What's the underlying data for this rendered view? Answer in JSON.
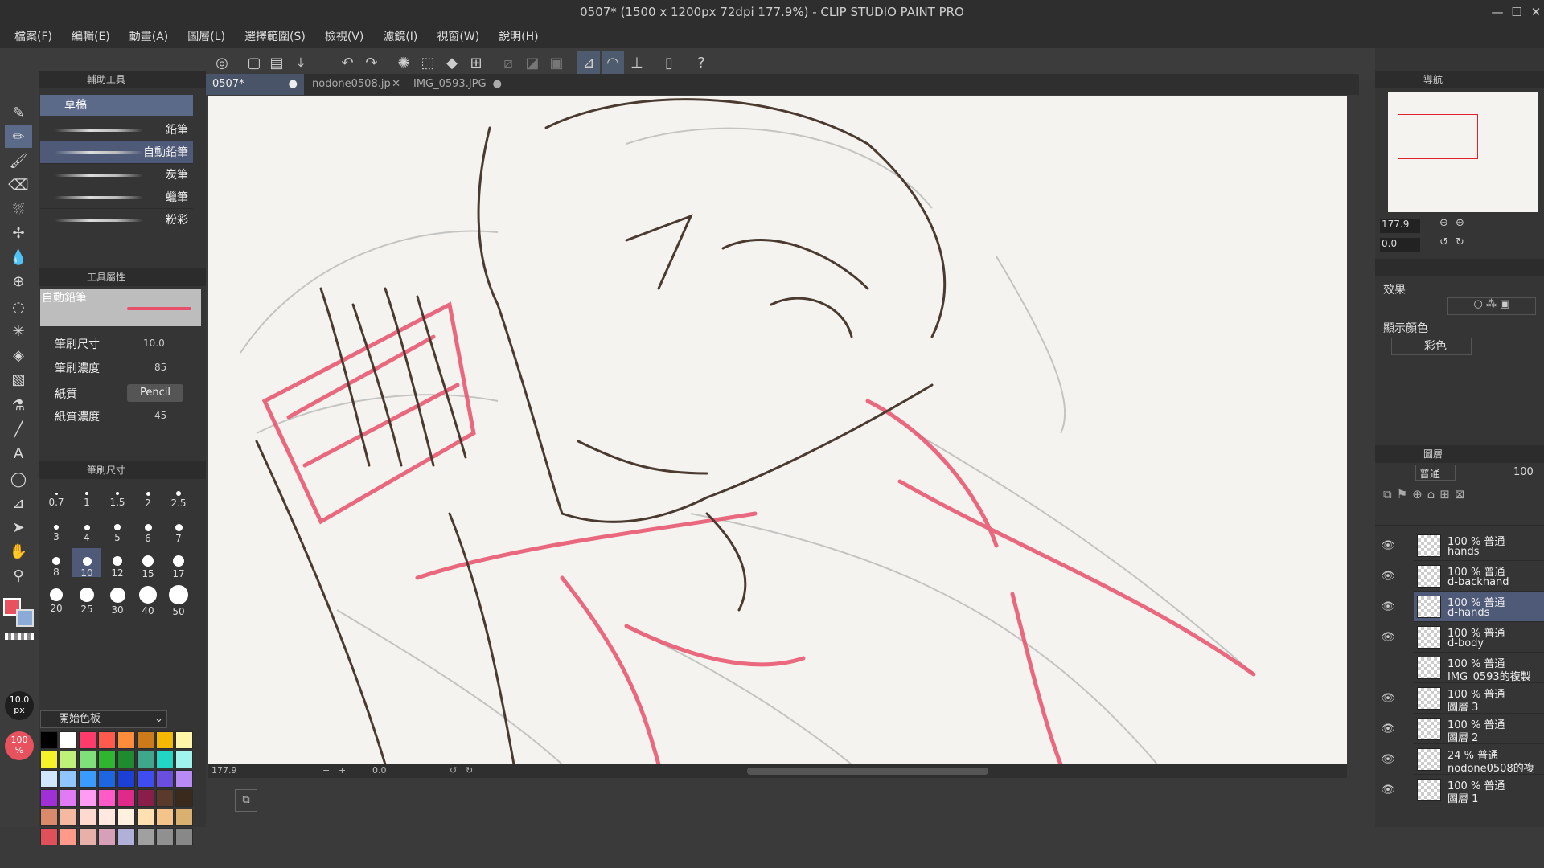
{
  "title": "0507* (1500 x 1200px 72dpi 177.9%)  - CLIP STUDIO PAINT PRO",
  "menu": [
    "檔案(F)",
    "編輯(E)",
    "動畫(A)",
    "圖層(L)",
    "選擇範圍(S)",
    "檢視(V)",
    "濾鏡(I)",
    "視窗(W)",
    "說明(H)"
  ],
  "tabs": [
    {
      "label": "0507*",
      "active": true
    },
    {
      "label": "nodone0508.jp",
      "active": false
    },
    {
      "label": "IMG_0593.JPG",
      "active": false
    }
  ],
  "sub_tool": {
    "panel_title": "輔助工具",
    "group": "草稿",
    "brushes": [
      "鉛筆",
      "自動鉛筆",
      "炭筆",
      "蠟筆",
      "粉彩"
    ],
    "selected": "自動鉛筆"
  },
  "tool_property": {
    "panel_title": "工具屬性",
    "preset_name": "自動鉛筆",
    "brush_size_label": "筆刷尺寸",
    "brush_size_value": "10.0",
    "brush_density_label": "筆刷濃度",
    "brush_density_value": "85",
    "paper_label": "紙質",
    "paper_value": "Pencil",
    "paper_density_label": "紙質濃度",
    "paper_density_value": "45"
  },
  "brush_size_panel": {
    "panel_title": "筆刷尺寸",
    "sizes": [
      "0.7",
      "1",
      "1.5",
      "2",
      "2.5",
      "3",
      "4",
      "5",
      "6",
      "7",
      "8",
      "10",
      "12",
      "15",
      "17",
      "20",
      "25",
      "30",
      "40",
      "50"
    ],
    "selected": "10"
  },
  "color_set": {
    "name": "開始色板",
    "swatches": [
      "#000000",
      "#ffffff",
      "#ff3b6b",
      "#ff5a4e",
      "#ff8c3a",
      "#cc7a1a",
      "#f5b800",
      "#fff7a8",
      "#f5f22a",
      "#bff07a",
      "#7fe07a",
      "#2fb52f",
      "#1e8c2e",
      "#3fa88a",
      "#22d6c4",
      "#9ff5ee",
      "#cfe8ff",
      "#8fc6ff",
      "#3a9bff",
      "#1e66e0",
      "#1c3fd6",
      "#3f4cf0",
      "#6a4ee0",
      "#b88af5",
      "#a02fd6",
      "#e07af5",
      "#ff9af5",
      "#ff5ac8",
      "#e02a8a",
      "#8a1e4a",
      "#5a3a2a",
      "#3a2a1e",
      "#d98a6a",
      "#f5b8a0",
      "#ffd8d0",
      "#ffe8e0",
      "#fff0e0",
      "#ffe0b0",
      "#f5c48a",
      "#d9b070",
      "#e0505a",
      "#ff9a8a",
      "#e8b0a8",
      "#d8a0b8",
      "#b0b0d8",
      "#a0a0a0",
      "#909090",
      "#888888"
    ]
  },
  "left_status": {
    "brush_px": "10.0\npx",
    "opacity": "100\n%"
  },
  "status_bar": {
    "zoom": "177.9",
    "angle": "0.0"
  },
  "navigator": {
    "panel_title": "導航",
    "zoom": "177.9",
    "angle": "0.0"
  },
  "layer_property": {
    "effect_label": "效果",
    "display_color_label": "顯示顏色",
    "display_color_value": "彩色"
  },
  "layer_panel": {
    "panel_title": "圖層",
    "blend": "普通",
    "opacity": "100",
    "layers": [
      {
        "line1": "100 % 普通",
        "line2": "hands",
        "active": false,
        "visible": true
      },
      {
        "line1": "100 % 普通",
        "line2": "d-backhand",
        "active": false,
        "visible": true
      },
      {
        "line1": "100 % 普通",
        "line2": "d-hands",
        "active": true,
        "visible": true
      },
      {
        "line1": "100 % 普通",
        "line2": "d-body",
        "active": false,
        "visible": true
      },
      {
        "line1": "100 % 普通",
        "line2": "IMG_0593的複製",
        "active": false,
        "visible": false
      },
      {
        "line1": "100 % 普通",
        "line2": "圖層 3",
        "active": false,
        "visible": true
      },
      {
        "line1": "100 % 普通",
        "line2": "圖層 2",
        "active": false,
        "visible": true
      },
      {
        "line1": "24 % 普通",
        "line2": "nodone0508的複",
        "active": false,
        "visible": true
      },
      {
        "line1": "100 % 普通",
        "line2": "圖層 1",
        "active": false,
        "visible": true
      }
    ]
  },
  "colors": {
    "main": "#e8525e",
    "sub": "#8aaad8",
    "accent": "#4e5a78",
    "red_sketch": "#e8506a",
    "brown_line": "#4a3a30"
  }
}
